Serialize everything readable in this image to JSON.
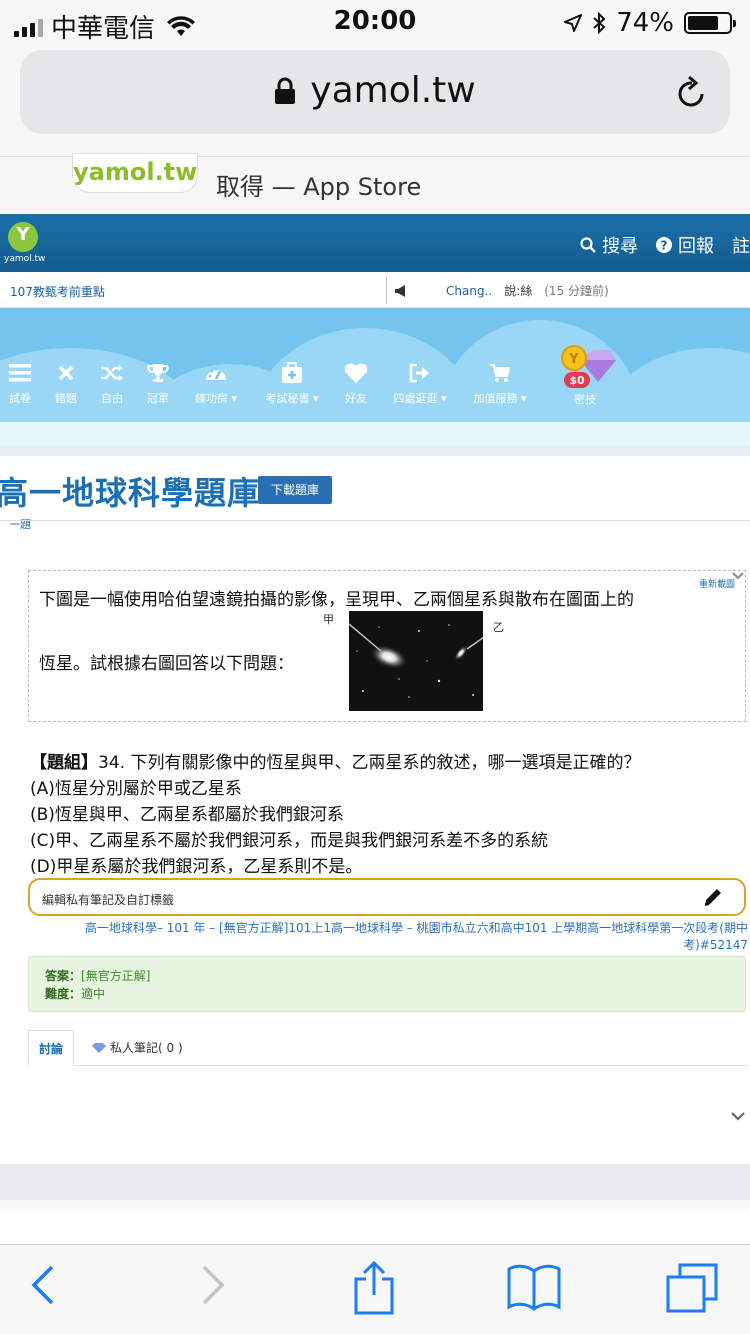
{
  "status_bar": {
    "carrier": "中華電信",
    "time": "20:00",
    "battery_percent": "74%",
    "battery_level": 0.74
  },
  "browser": {
    "url": "yamol.tw",
    "banner_logo": "yamol.tw",
    "banner_text": "取得 — App Store"
  },
  "site_header": {
    "logo_text": "yamol.tw",
    "links": [
      {
        "label": "搜尋",
        "icon": "search-icon"
      },
      {
        "label": "回報",
        "icon": "question-circle-icon"
      },
      {
        "label": "註",
        "icon": ""
      }
    ]
  },
  "ticker": {
    "left": "107教甄考前重點",
    "user": "Chang..",
    "message": "說:絲",
    "time": "(15 分鐘前)"
  },
  "nav": {
    "items": [
      {
        "label": "試卷",
        "icon": "menu-icon"
      },
      {
        "label": "錯題",
        "icon": "close-icon"
      },
      {
        "label": "自由",
        "icon": "shuffle-icon"
      },
      {
        "label": "冠軍",
        "icon": "trophy-icon"
      },
      {
        "label": "練功房 ▾",
        "icon": "dashboard-icon"
      },
      {
        "label": "考試秘書 ▾",
        "icon": "briefcase-icon"
      },
      {
        "label": "好友",
        "icon": "heart-icon"
      },
      {
        "label": "四處逛逛 ▾",
        "icon": "exit-icon"
      },
      {
        "label": "加值服務 ▾",
        "icon": "cart-icon"
      }
    ],
    "special_label": "密技",
    "special_badge": "$0"
  },
  "page": {
    "title": "高一地球科學題庫",
    "download_button": "下載題庫",
    "prev_link": "上一題"
  },
  "question_block": {
    "text_1": "下圖是一幅使用哈伯望遠鏡拍攝的影像，呈現甲、乙兩個星系與散布在圖面上的",
    "text_2": "恆星。試根據右圖回答以下問題：",
    "refresh": "重新載圖",
    "galaxy_label_1": "甲",
    "galaxy_label_2": "乙"
  },
  "question": {
    "tag": "【題組】",
    "stem": "34. 下列有關影像中的恆星與甲、乙兩星系的敘述，哪一選項是正確的？",
    "options": [
      "(A)恆星分別屬於甲或乙星系",
      "(B)恆星與甲、乙兩星系都屬於我們銀河系",
      "(C)甲、乙兩星系不屬於我們銀河系，而是與我們銀河系差不多的系統",
      "(D)甲星系屬於我們銀河系，乙星系則不是。"
    ]
  },
  "note": {
    "label": "編輯私有筆記及自訂標籤"
  },
  "source": {
    "text": "高一地球科學– 101 年 – [無官方正解]101上1高一地球科學 – 桃園市私立六和高中101 上學期高一地球科學第一次段考(期中考)#52147"
  },
  "answer": {
    "answer_label": "答案：",
    "answer_value": "[無官方正解]",
    "difficulty_label": "難度：",
    "difficulty_value": "適中"
  },
  "tabs": {
    "discussion": "討論",
    "notes": "私人筆記( 0 )"
  },
  "colors": {
    "header_blue": "#1a6fa8",
    "sky_blue": "#73c4ee",
    "title_blue": "#1c6fb6",
    "note_border": "#d4a52a",
    "answer_bg": "#e7f4df",
    "ios_blue": "#1b7cf6"
  }
}
